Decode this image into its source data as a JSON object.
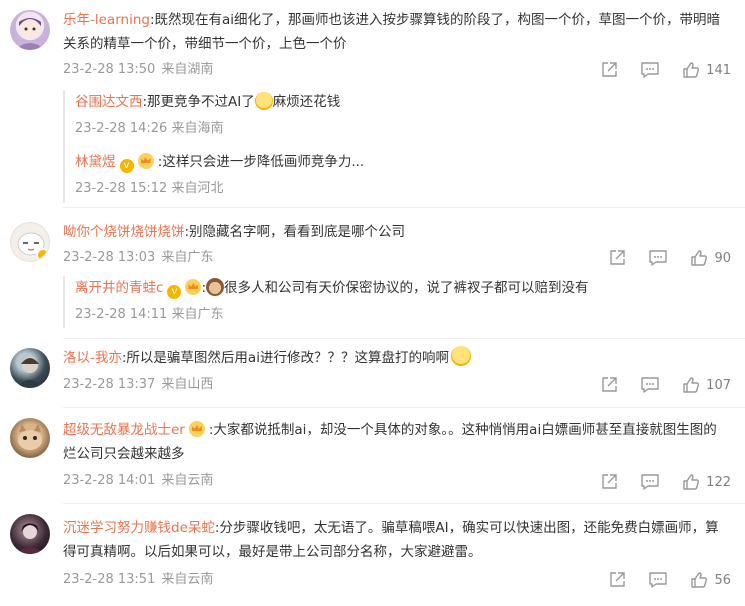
{
  "comments": [
    {
      "user": "乐年-learning",
      "text": ":既然现在有ai细化了，那画师也该进入按步骤算钱的阶段了，构图一个价，草图一个价，带明暗关系的精草一个价，带细节一个价，上色一个价",
      "time": "23-2-28 13:50",
      "location": "来自湖南",
      "likes": "141",
      "replies": [
        {
          "user": "谷围达文西",
          "text_before": ":那更竞争不过AI了",
          "text_after": "麻烦还花钱",
          "time": "23-2-28 14:26",
          "location": "来自海南"
        },
        {
          "user": "林黛煜",
          "text_before": ":这样只会进一步降低画师竞争力...",
          "text_after": "",
          "time": "23-2-28 15:12",
          "location": "来自河北"
        }
      ]
    },
    {
      "user": "呦你个烧饼烧饼烧饼",
      "text": ":别隐藏名字啊，看看到底是哪个公司",
      "time": "23-2-28 13:03",
      "location": "来自广东",
      "likes": "90",
      "replies": [
        {
          "user": "离开井的青蛙c",
          "text_before": ":",
          "text_after": "很多人和公司有天价保密协议的，说了裤衩子都可以赔到没有",
          "time": "23-2-28 14:11",
          "location": "来自广东"
        }
      ]
    },
    {
      "user": "洛以-我亦",
      "text": ":所以是骗草图然后用ai进行修改？？？这算盘打的响啊",
      "time": "23-2-28 13:37",
      "location": "来自山西",
      "likes": "107"
    },
    {
      "user": "超级无敌暴龙战士er",
      "text": ":大家都说抵制ai，却没一个具体的对象。。这种悄悄用ai白嫖画师甚至直接就图生图的烂公司只会越来越多",
      "time": "23-2-28 14:01",
      "location": "来自云南",
      "likes": "122"
    },
    {
      "user": "沉迷学习努力赚钱de呆蛇",
      "text": ":分步骤收钱吧，太无语了。骗草稿喂AI，确实可以快速出图，还能免费白嫖画师，算得可真精啊。以后如果可以，最好是带上公司部分名称，大家避避雷。",
      "time": "23-2-28 13:51",
      "location": "来自云南",
      "likes": "56"
    }
  ],
  "colors": {
    "username": "#eb7350",
    "meta": "#999999",
    "text": "#333333"
  },
  "icons": {
    "share": "share-icon",
    "comment": "comment-icon",
    "like": "thumbs-up-icon"
  }
}
